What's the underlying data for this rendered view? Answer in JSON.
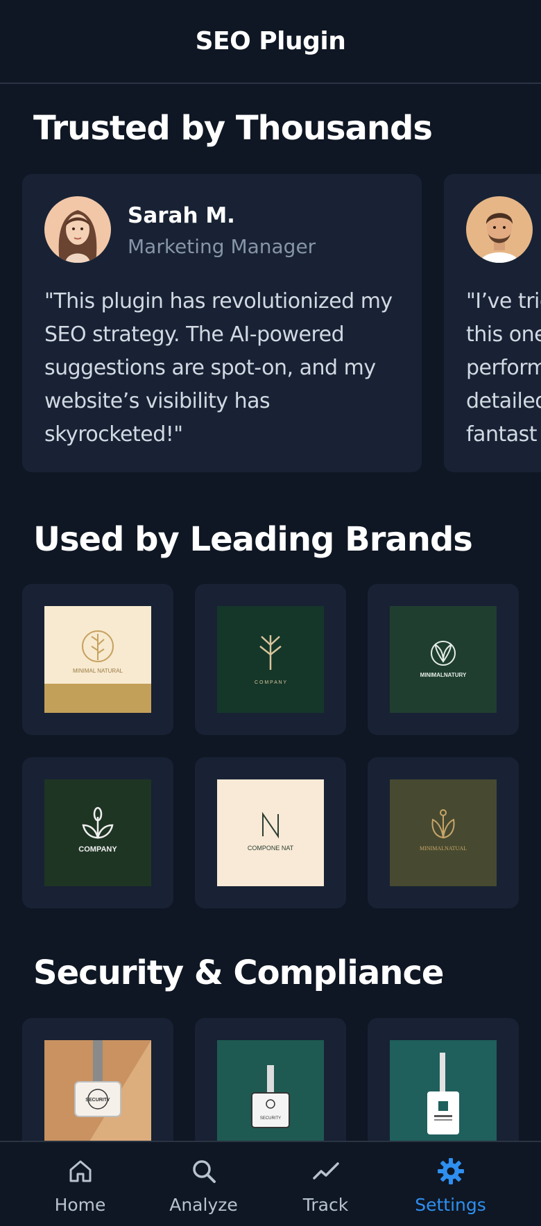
{
  "header": {
    "title": "SEO Plugin"
  },
  "testimonials": {
    "title": "Trusted by Thousands",
    "items": [
      {
        "name": "Sarah M.",
        "role": "Marketing Manager",
        "quote": "\"This plugin has revolutionized my SEO strategy. The AI-powered suggestions are spot-on, and my website’s visibility has skyrocketed!\""
      },
      {
        "name": "",
        "role": "",
        "quote": "\"I’ve trie\nthis one\nperform\ndetailed\nfantast"
      }
    ]
  },
  "brands": {
    "title": "Used by Leading Brands",
    "logos": [
      {
        "text": "MINIMAL NATURAL",
        "bg": "#f7ead0",
        "fg": "#b89457"
      },
      {
        "text": "C O M P A N Y",
        "bg": "#15372a",
        "fg": "#d8c49a"
      },
      {
        "text": "MINIMALNATURY",
        "bg": "#1f3e30",
        "fg": "#e6ede8"
      },
      {
        "text": "COMPANY",
        "bg": "#1f3524",
        "fg": "#f0f0f0"
      },
      {
        "text": "COMPONE NAT",
        "bg": "#f8ead6",
        "fg": "#2b3d33"
      },
      {
        "text": "MINIMALNATUAL",
        "bg": "#474a30",
        "fg": "#c9a56a"
      }
    ]
  },
  "security": {
    "title": "Security & Compliance",
    "badges": [
      {
        "text": "SECURITY",
        "bg": "#c99260"
      },
      {
        "text": "SECURITY",
        "bg": "#1e5a52"
      },
      {
        "text": "",
        "bg": "#1f5f5c"
      }
    ]
  },
  "tabs": [
    {
      "label": "Home",
      "icon": "home-icon",
      "active": false
    },
    {
      "label": "Analyze",
      "icon": "search-icon",
      "active": false
    },
    {
      "label": "Track",
      "icon": "trend-line-icon",
      "active": false
    },
    {
      "label": "Settings",
      "icon": "gear-icon",
      "active": true
    }
  ],
  "colors": {
    "accent": "#2f8ff0",
    "background": "#0f1724",
    "card": "#182234"
  }
}
